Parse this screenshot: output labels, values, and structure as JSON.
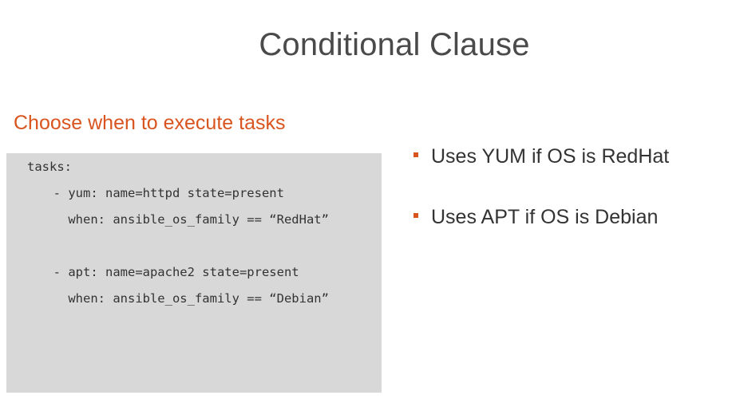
{
  "slide": {
    "title": "Conditional Clause",
    "subtitle": "Choose when to execute tasks"
  },
  "code": {
    "lines": [
      "tasks:",
      "  - yum: name=httpd state=present",
      "    when: ansible_os_family == “RedHat”",
      "  - apt: name=apache2 state=present",
      "    when: ansible_os_family == “Debian”"
    ]
  },
  "bullets": [
    "Uses YUM if OS is RedHat",
    "Uses APT if OS is Debian"
  ],
  "colors": {
    "accent": "#d9541e",
    "code_background": "#d8d8d8",
    "title_text": "#4a4a4a"
  }
}
